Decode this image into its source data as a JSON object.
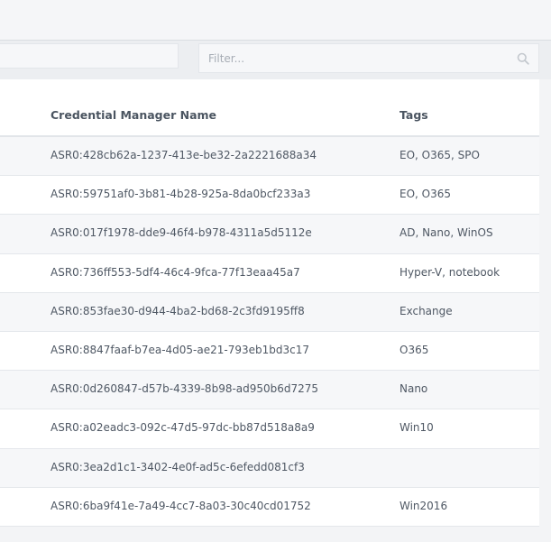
{
  "filter": {
    "placeholder": "Filter...",
    "value": ""
  },
  "icons": {
    "search": "search-icon"
  },
  "table": {
    "columns": {
      "name": "Credential Manager Name",
      "tags": "Tags"
    },
    "rows": [
      {
        "name": "ASR0:428cb62a-1237-413e-be32-2a2221688a34",
        "tags": "EO, O365, SPO"
      },
      {
        "name": "ASR0:59751af0-3b81-4b28-925a-8da0bcf233a3",
        "tags": "EO, O365"
      },
      {
        "name": "ASR0:017f1978-dde9-46f4-b978-4311a5d5112e",
        "tags": "AD, Nano, WinOS"
      },
      {
        "name": "ASR0:736ff553-5df4-46c4-9fca-77f13eaa45a7",
        "tags": "Hyper-V, notebook"
      },
      {
        "name": "ASR0:853fae30-d944-4ba2-bd68-2c3fd9195ff8",
        "tags": "Exchange"
      },
      {
        "name": "ASR0:8847faaf-b7ea-4d05-ae21-793eb1bd3c17",
        "tags": "O365"
      },
      {
        "name": "ASR0:0d260847-d57b-4339-8b98-ad950b6d7275",
        "tags": "Nano"
      },
      {
        "name": "ASR0:a02eadc3-092c-47d5-97dc-bb87d518a8a9",
        "tags": "Win10"
      },
      {
        "name": "ASR0:3ea2d1c1-3402-4e0f-ad5c-6efedd081cf3",
        "tags": ""
      },
      {
        "name": "ASR0:6ba9f41e-7a49-4cc7-8a03-30c40cd01752",
        "tags": "Win2016"
      }
    ]
  }
}
